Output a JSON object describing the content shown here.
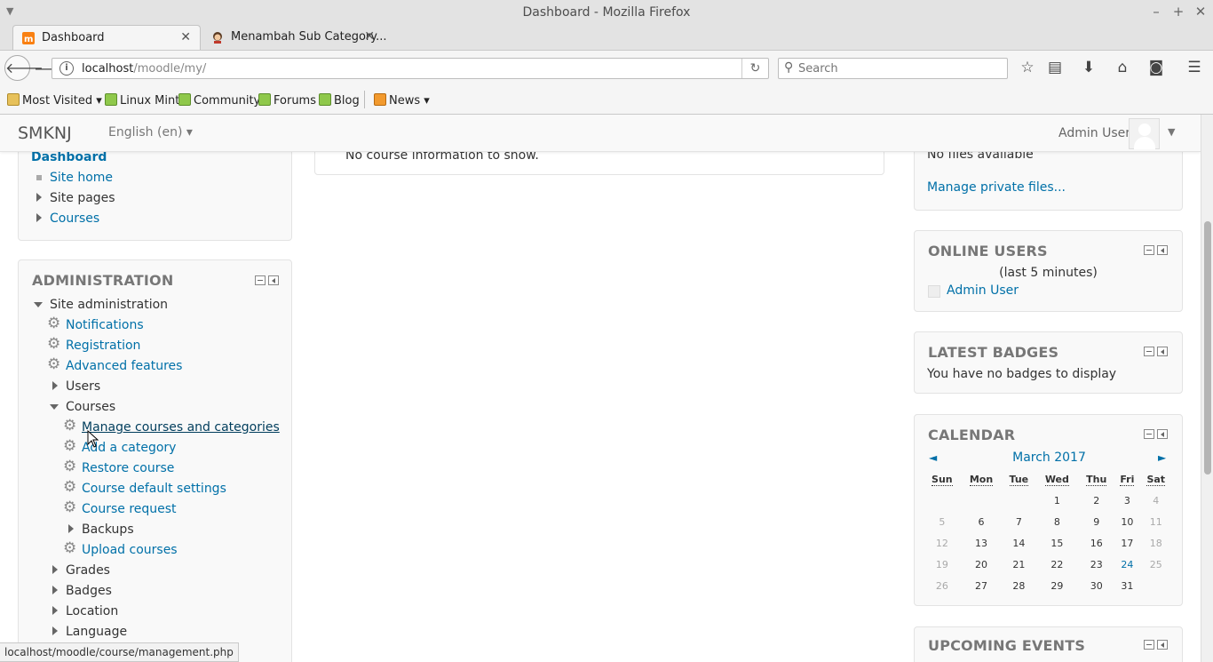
{
  "window": {
    "title": "Dashboard - Mozilla Firefox"
  },
  "tabs": [
    {
      "label": "Dashboard",
      "active": true,
      "icon": "moodle-favicon"
    },
    {
      "label": "Menambah Sub Category...",
      "active": false,
      "icon": "avatar-favicon"
    }
  ],
  "navbar": {
    "url_host": "localhost",
    "url_path": "/moodle/my/",
    "search_placeholder": "Search"
  },
  "bookmarks": [
    {
      "label": "Most Visited",
      "icon": "folder-icon",
      "dropdown": true
    },
    {
      "label": "Linux Mint",
      "icon": "mint-icon"
    },
    {
      "label": "Community",
      "icon": "mint-icon"
    },
    {
      "label": "Forums",
      "icon": "mint-icon"
    },
    {
      "label": "Blog",
      "icon": "mint-icon"
    },
    {
      "label": "News",
      "icon": "rss-icon",
      "dropdown": true
    }
  ],
  "moodle": {
    "brand": "SMKNJ",
    "language": "English (en)",
    "user_name": "Admin User"
  },
  "navigation": {
    "current": "Dashboard",
    "items": [
      "Site home",
      "Site pages",
      "Courses"
    ]
  },
  "main": {
    "no_course_text": "No course information to show."
  },
  "administration": {
    "title": "ADMINISTRATION",
    "site_admin": "Site administration",
    "items": {
      "notifications": "Notifications",
      "registration": "Registration",
      "advanced": "Advanced features",
      "users": "Users",
      "courses": "Courses",
      "manage": "Manage courses and categories",
      "add_category": "Add a category",
      "restore": "Restore course",
      "defaults": "Course default settings",
      "request": "Course request",
      "backups": "Backups",
      "upload": "Upload courses",
      "grades": "Grades",
      "badges": "Badges",
      "location": "Location",
      "language": "Language"
    }
  },
  "private_files": {
    "no_files": "No files available",
    "manage_link": "Manage private files..."
  },
  "online_users": {
    "title": "ONLINE USERS",
    "subtitle": "(last 5 minutes)",
    "user": "Admin User"
  },
  "latest_badges": {
    "title": "LATEST BADGES",
    "text": "You have no badges to display"
  },
  "calendar": {
    "title": "CALENDAR",
    "month": "March 2017",
    "prev": "◄",
    "next": "►",
    "weekdays": [
      "Sun",
      "Mon",
      "Tue",
      "Wed",
      "Thu",
      "Fri",
      "Sat"
    ],
    "weeks": [
      [
        "",
        "",
        "",
        "1",
        "2",
        "3",
        "4"
      ],
      [
        "5",
        "6",
        "7",
        "8",
        "9",
        "10",
        "11"
      ],
      [
        "12",
        "13",
        "14",
        "15",
        "16",
        "17",
        "18"
      ],
      [
        "19",
        "20",
        "21",
        "22",
        "23",
        "24",
        "25"
      ],
      [
        "26",
        "27",
        "28",
        "29",
        "30",
        "31",
        ""
      ]
    ],
    "today": "24"
  },
  "upcoming_events": {
    "title": "UPCOMING EVENTS"
  },
  "statusbar": {
    "url": "localhost/moodle/course/management.php"
  }
}
